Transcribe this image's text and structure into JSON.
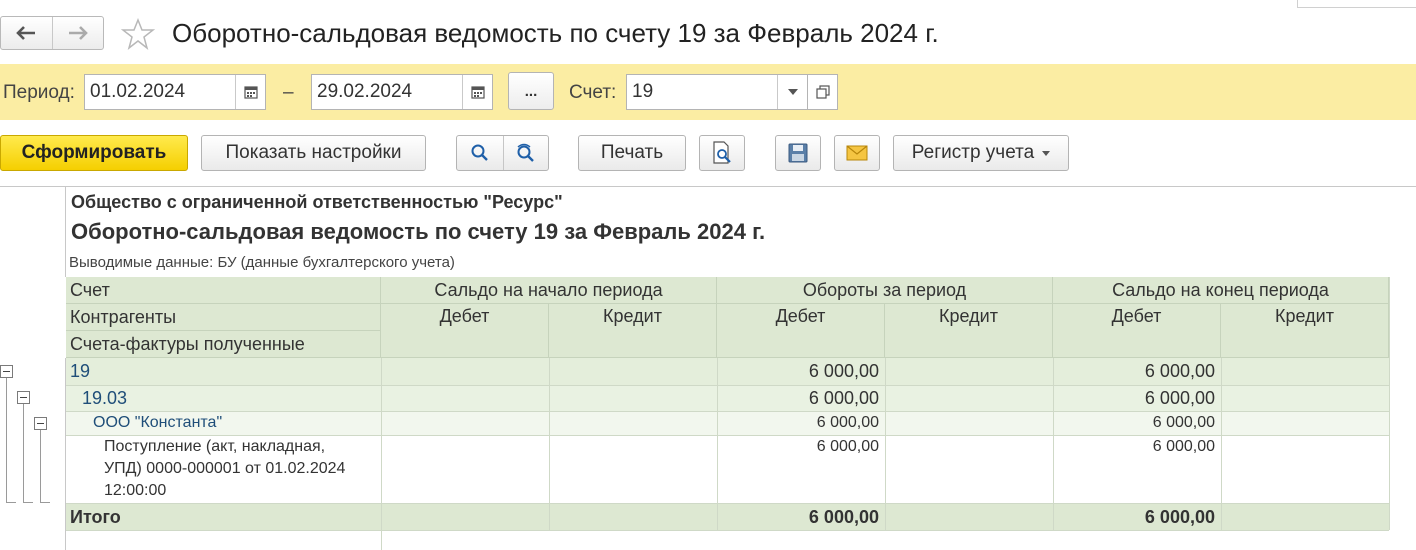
{
  "window": {
    "title": "Оборотно-сальдовая ведомость по счету 19 за Февраль 2024 г."
  },
  "icons": {
    "back": "arrow-left-icon",
    "forward": "arrow-right-icon",
    "favorite": "star-icon",
    "calendar": "calendar-icon",
    "dropdown": "chevron-down-icon",
    "open": "open-window-icon",
    "search": "search-icon",
    "search_advanced": "search-refresh-icon",
    "preview": "print-preview-icon",
    "save": "floppy-disk-icon",
    "email": "envelope-icon"
  },
  "colors": {
    "period_bar": "#fbeda3",
    "primary_button": "#f5cf00",
    "header_bg": "#dde8d2",
    "group_bg": "#e4eedb",
    "account_text": "#1f4e79"
  },
  "filters": {
    "period_label": "Период:",
    "date_from": "01.02.2024",
    "dash": "–",
    "date_to": "29.02.2024",
    "more_label": "...",
    "account_label": "Счет:",
    "account_value": "19"
  },
  "toolbar": {
    "generate": "Сформировать",
    "show_settings": "Показать настройки",
    "print": "Печать",
    "register": "Регистр учета"
  },
  "report": {
    "organization": "Общество с ограниченной ответственностью \"Ресурс\"",
    "title": "Оборотно-сальдовая ведомость по счету 19 за Февраль 2024 г.",
    "subtitle": "Выводимые данные: БУ (данные бухгалтерского учета)",
    "header": {
      "row_labels": [
        "Счет",
        "Контрагенты",
        "Счета-фактуры полученные"
      ],
      "groups": [
        "Сальдо на начало периода",
        "Обороты за период",
        "Сальдо на конец периода"
      ],
      "debit": "Дебет",
      "credit": "Кредит"
    },
    "rows": [
      {
        "name": "19",
        "turnover_debit": "6 000,00",
        "end_debit": "6 000,00"
      },
      {
        "name": "19.03",
        "turnover_debit": "6 000,00",
        "end_debit": "6 000,00"
      },
      {
        "name": "ООО \"Константа\"",
        "turnover_debit": "6 000,00",
        "end_debit": "6 000,00"
      },
      {
        "name_lines": [
          "Поступление (акт, накладная,",
          "УПД) 0000-000001 от 01.02.2024",
          "12:00:00"
        ],
        "turnover_debit": "6 000,00",
        "end_debit": "6 000,00"
      }
    ],
    "total": {
      "label": "Итого",
      "turnover_debit": "6 000,00",
      "end_debit": "6 000,00"
    }
  }
}
